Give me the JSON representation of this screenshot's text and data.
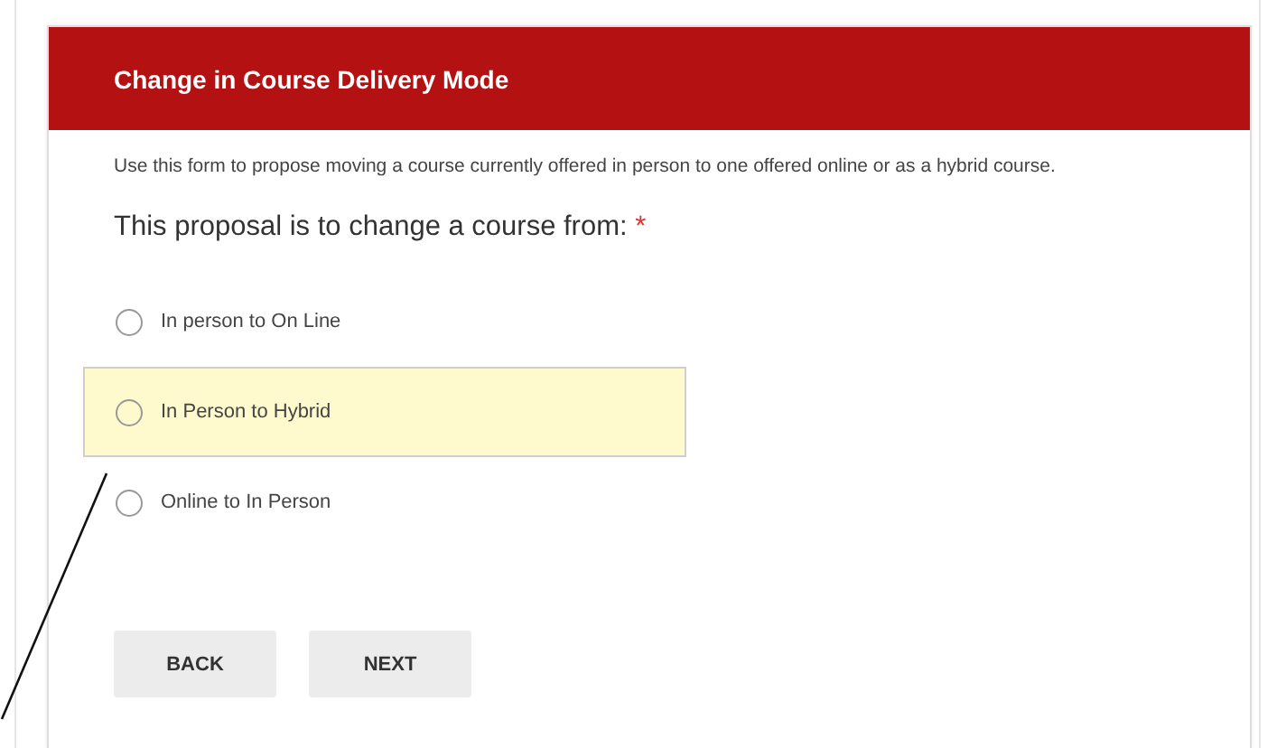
{
  "form": {
    "title": "Change in Course Delivery Mode",
    "description": "Use this form to propose moving a course currently offered in person to one offered online or as a hybrid course.",
    "question": "This proposal is to change a course from:",
    "required_mark": "*",
    "options": [
      {
        "label": "In person to On Line",
        "selected": false,
        "highlighted": false
      },
      {
        "label": "In Person to Hybrid",
        "selected": false,
        "highlighted": true
      },
      {
        "label": "Online to In Person",
        "selected": false,
        "highlighted": false
      }
    ],
    "buttons": [
      "BACK",
      "NEXT"
    ],
    "annotation": {
      "kind": "leader-line"
    }
  }
}
